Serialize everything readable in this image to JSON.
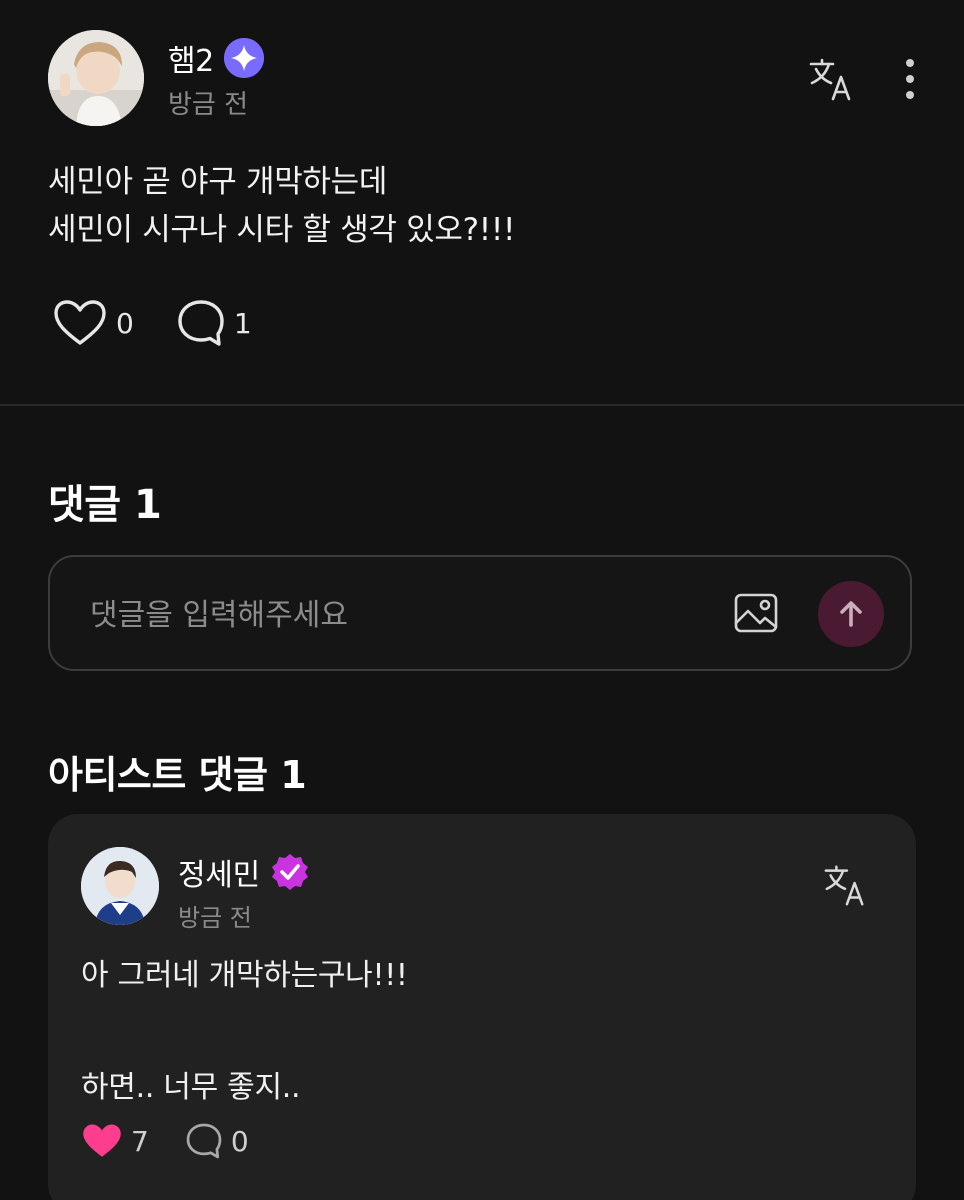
{
  "post": {
    "author": {
      "name": "햄2",
      "time": "방금 전"
    },
    "body_lines": [
      "세민아 곧 야구 개막하는데",
      "세민이 시구나 시타 할 생각 있오?!!!"
    ],
    "likes": "0",
    "comments": "1"
  },
  "comments_section": {
    "title": "댓글 1",
    "input": {
      "placeholder": "댓글을 입력해주세요"
    }
  },
  "artist_section": {
    "title": "아티스트 댓글 1",
    "comment": {
      "author": "정세민",
      "time": "방금 전",
      "body_lines": [
        "아 그러네 개막하는구나!!!",
        "",
        "하면.. 너무 좋지.."
      ],
      "likes": "7",
      "replies": "0"
    }
  },
  "colors": {
    "background": "#121212",
    "card": "#212121",
    "heart_active": "#ff3d8e",
    "verified_badge": "#c934e0",
    "sparkle_badge": "#7a6bff",
    "send_button": "#4a1a32"
  },
  "icons": [
    "sparkle-badge-icon",
    "translate-icon",
    "more-vertical-icon",
    "heart-outline-icon",
    "comment-bubble-icon",
    "image-icon",
    "arrow-up-icon",
    "verified-badge-icon",
    "heart-filled-icon"
  ]
}
